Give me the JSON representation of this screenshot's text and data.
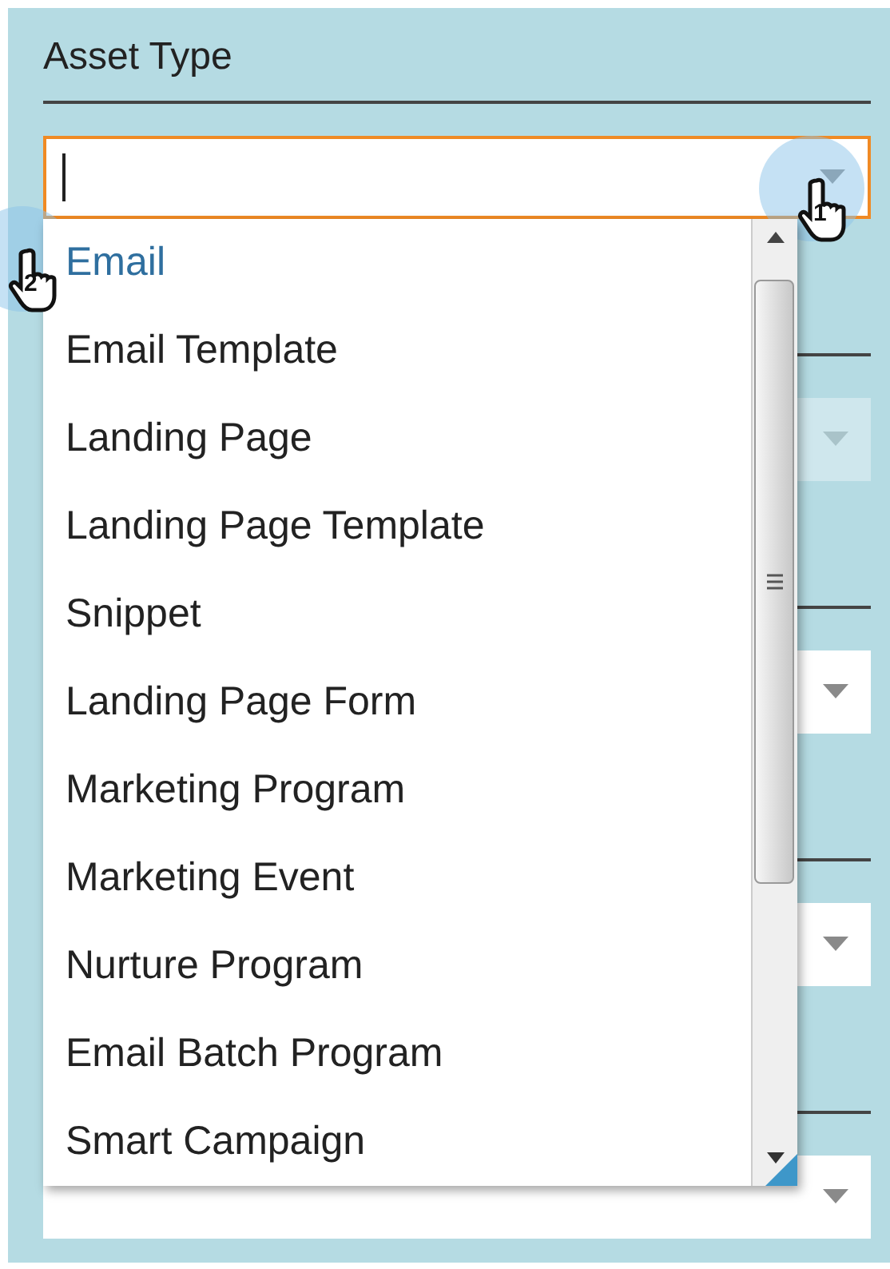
{
  "field_label": "Asset Type",
  "asset_type_input": {
    "focused": true
  },
  "background_fields": [
    {
      "disabled": true
    },
    {
      "disabled": false
    },
    {
      "disabled": false
    },
    {
      "disabled": false
    }
  ],
  "dropdown_options": [
    {
      "label": "Email",
      "selected": true
    },
    {
      "label": "Email Template",
      "selected": false
    },
    {
      "label": "Landing Page",
      "selected": false
    },
    {
      "label": "Landing Page Template",
      "selected": false
    },
    {
      "label": "Snippet",
      "selected": false
    },
    {
      "label": "Landing Page Form",
      "selected": false
    },
    {
      "label": "Marketing Program",
      "selected": false
    },
    {
      "label": "Marketing Event",
      "selected": false
    },
    {
      "label": "Nurture Program",
      "selected": false
    },
    {
      "label": "Email Batch Program",
      "selected": false
    },
    {
      "label": "Smart Campaign",
      "selected": false
    }
  ],
  "annotations": [
    {
      "label": "1"
    },
    {
      "label": "2"
    }
  ]
}
